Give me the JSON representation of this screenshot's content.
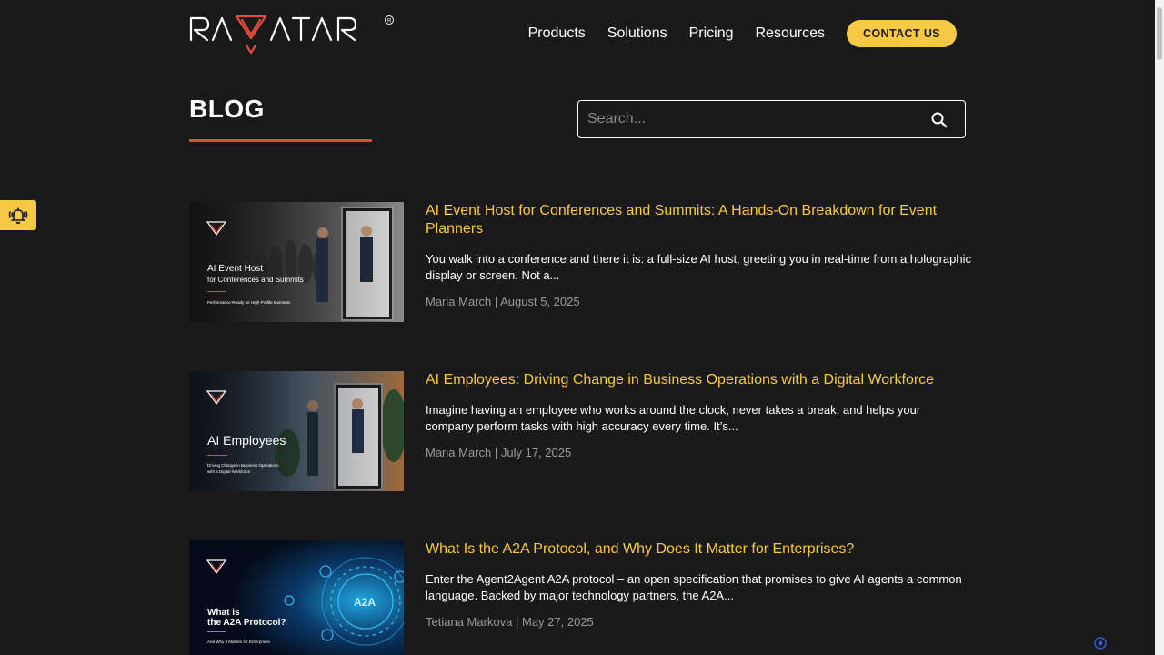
{
  "header": {
    "logo_text": "RAVATAR",
    "nav": [
      {
        "label": "Products"
      },
      {
        "label": "Solutions"
      },
      {
        "label": "Pricing"
      },
      {
        "label": "Resources"
      }
    ],
    "contact_label": "CONTACT US"
  },
  "page": {
    "title": "BLOG",
    "search_placeholder": "Search..."
  },
  "posts": [
    {
      "title": "AI Event Host for Conferences and Summits: A Hands-On Breakdown for Event Planners",
      "excerpt": "You walk into a conference and there it is: a full-size AI host, greeting you in real-time from a holographic display or screen. Not a...",
      "author": "Maria March",
      "separator": " | ",
      "date": "August 5, 2025",
      "thumb": {
        "line1": "AI Event Host",
        "line2": "for Conferences and Summits",
        "line3": "Performance-Ready for High-Profile Moments"
      }
    },
    {
      "title": "AI Employees: Driving Change in Business Operations with a Digital Workforce",
      "excerpt": "Imagine having an employee who works around the clock, never takes a break, and helps your company perform tasks with high accuracy every time. It’s...",
      "author": "Maria March",
      "separator": " | ",
      "date": "July 17, 2025",
      "thumb": {
        "line1": "AI Employees",
        "line2": "Driving Change in Business Operations",
        "line3": "with a Digital Workforce"
      }
    },
    {
      "title": "What Is the A2A Protocol, and Why Does It Matter for Enterprises?",
      "excerpt": "Enter the Agent2Agent A2A protocol – an open specification that promises to give AI agents a common language. Backed by major technology partners, the A2A...",
      "author": "Tetiana Markova",
      "separator": " | ",
      "date": "May 27, 2025",
      "thumb": {
        "line1": "What is",
        "line2": "the A2A Protocol?",
        "line3": "And Why It Matters for Enterprises",
        "badge": "A2A"
      }
    }
  ],
  "colors": {
    "background": "#1a1a1a",
    "accent_yellow": "#f7c843",
    "accent_red": "#e24a3b",
    "meta_gray": "#9a9a9a"
  },
  "icons": {
    "search": "search-icon",
    "alert": "alarm-bell-icon",
    "logo_mark": "triangle-logo-icon"
  }
}
